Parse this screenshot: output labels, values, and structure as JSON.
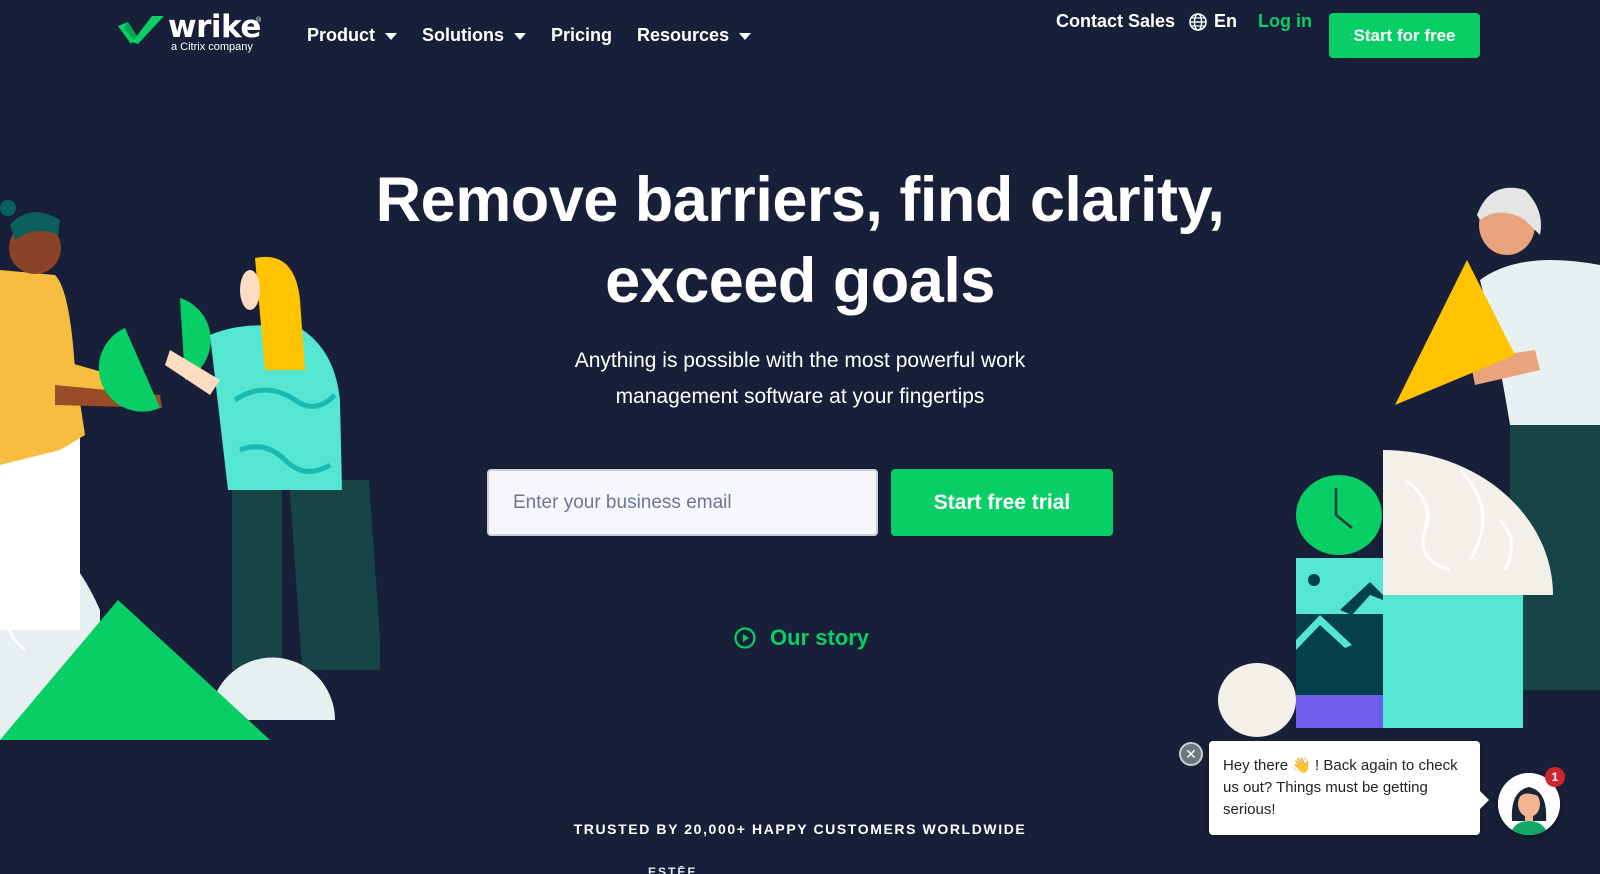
{
  "nav": {
    "logo": {
      "word": "wrike",
      "registered": "®",
      "subtitle": "a Citrix company"
    },
    "menu": [
      {
        "label": "Product",
        "has_dropdown": true
      },
      {
        "label": "Solutions",
        "has_dropdown": true
      },
      {
        "label": "Pricing",
        "has_dropdown": false
      },
      {
        "label": "Resources",
        "has_dropdown": true
      }
    ],
    "contact_sales": "Contact Sales",
    "language": {
      "icon": "globe-icon",
      "label": "En"
    },
    "login": "Log in",
    "start_for_free": "Start for free"
  },
  "hero": {
    "title_line1": "Remove barriers, find clarity,",
    "title_line2": "exceed goals",
    "subtitle_line1": "Anything is possible with the most powerful work",
    "subtitle_line2": "management software at your fingertips",
    "email_placeholder": "Enter your business email",
    "email_value": "",
    "trial_button": "Start free trial",
    "our_story": "Our story"
  },
  "trusted": {
    "text": "TRUSTED BY 20,000+ HAPPY CUSTOMERS WORLDWIDE",
    "partial_logo_text": "ESTĒE"
  },
  "chat": {
    "message": "Hey there 👋 ! Back again to check us out? Things must be getting serious!",
    "badge_count": "1",
    "close_icon": "close-icon"
  },
  "colors": {
    "background": "#181f38",
    "brand_green": "#08cf65",
    "teal": "#56e8d3",
    "yellow": "#ffc300",
    "purple": "#6e5ee9",
    "badge_red": "#d0242b"
  }
}
